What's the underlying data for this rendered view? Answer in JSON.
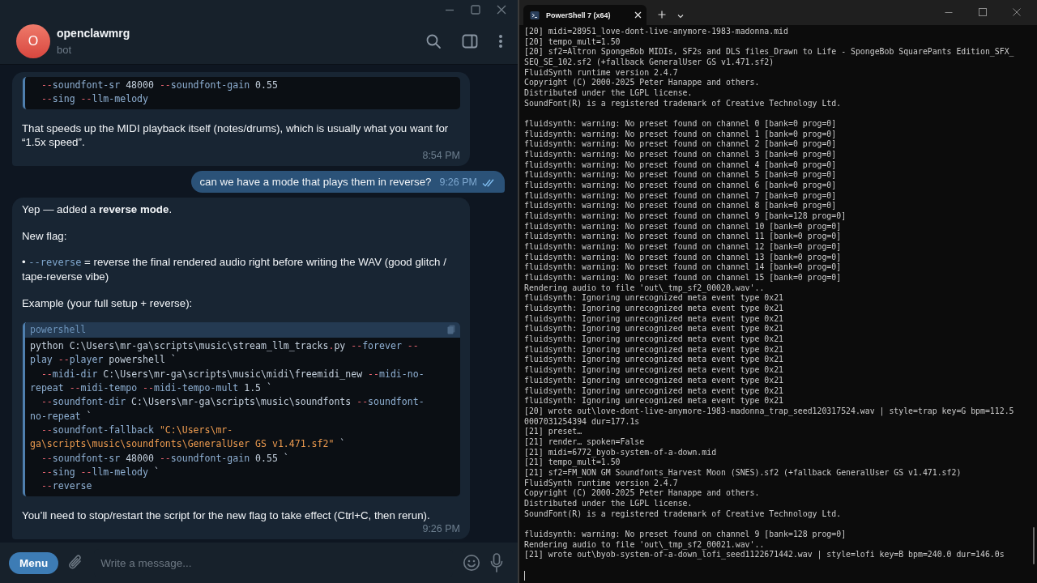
{
  "chat": {
    "avatar_letter": "O",
    "name": "openclawmrg",
    "status": "bot"
  },
  "messages": [
    {
      "kind": "in",
      "time": "8:54 PM",
      "blocks": [
        {
          "kind": "code",
          "lines": [
            {
              "indent": true,
              "tokens": [
                {
                  "kind": "op",
                  "text": "--"
                },
                {
                  "kind": "param",
                  "text": "soundfont-sr"
                },
                {
                  "kind": "plain",
                  "text": " 48000 "
                },
                {
                  "kind": "op",
                  "text": "--"
                },
                {
                  "kind": "param",
                  "text": "soundfont-gain"
                },
                {
                  "kind": "plain",
                  "text": " 0.55"
                }
              ]
            },
            {
              "indent": true,
              "tokens": [
                {
                  "kind": "op",
                  "text": "--"
                },
                {
                  "kind": "param",
                  "text": "sing "
                },
                {
                  "kind": "op",
                  "text": "--"
                },
                {
                  "kind": "param",
                  "text": "llm-melody"
                }
              ]
            }
          ]
        },
        {
          "kind": "text",
          "parts": [
            {
              "kind": "plain",
              "text": "That speeds up the MIDI playback itself (notes/drums), which is usually what you want for “1.5x speed”."
            }
          ]
        }
      ]
    },
    {
      "kind": "out",
      "time": "9:26 PM",
      "read": true,
      "blocks": [
        {
          "kind": "text",
          "parts": [
            {
              "kind": "plain",
              "text": "can we have a mode that plays them in reverse?"
            }
          ]
        }
      ]
    },
    {
      "kind": "in",
      "time": "9:26 PM",
      "blocks": [
        {
          "kind": "text",
          "parts": [
            {
              "kind": "plain",
              "text": "Yep — added a "
            },
            {
              "kind": "bold",
              "text": "reverse mode"
            },
            {
              "kind": "plain",
              "text": "."
            }
          ]
        },
        {
          "kind": "text",
          "parts": [
            {
              "kind": "plain",
              "text": "New flag:"
            }
          ]
        },
        {
          "kind": "text",
          "parts": [
            {
              "kind": "plain",
              "text": "• "
            },
            {
              "kind": "code",
              "text": "--reverse"
            },
            {
              "kind": "plain",
              "text": " = reverse the final rendered audio right before writing the WAV (good glitch / tape-reverse vibe)"
            }
          ]
        },
        {
          "kind": "text",
          "parts": [
            {
              "kind": "plain",
              "text": "Example (your full setup + reverse):"
            }
          ]
        },
        {
          "kind": "code",
          "language": "powershell",
          "lines": [
            {
              "indent": false,
              "tokens": [
                {
                  "kind": "plain",
                  "text": "python C:\\Users\\mr-ga\\scripts\\music\\stream_llm_tracks"
                },
                {
                  "kind": "op",
                  "text": "."
                },
                {
                  "kind": "plain",
                  "text": "py "
                },
                {
                  "kind": "op",
                  "text": "--"
                },
                {
                  "kind": "param",
                  "text": "forever "
                },
                {
                  "kind": "op",
                  "text": "--"
                }
              ]
            },
            {
              "indent": false,
              "tokens": [
                {
                  "kind": "param",
                  "text": "play "
                },
                {
                  "kind": "op",
                  "text": "--"
                },
                {
                  "kind": "param",
                  "text": "player"
                },
                {
                  "kind": "plain",
                  "text": " powershell `"
                }
              ]
            },
            {
              "indent": true,
              "tokens": [
                {
                  "kind": "op",
                  "text": "--"
                },
                {
                  "kind": "param",
                  "text": "midi-dir"
                },
                {
                  "kind": "plain",
                  "text": " C:\\Users\\mr-ga\\scripts\\music\\midi\\freemidi_new "
                },
                {
                  "kind": "op",
                  "text": "--"
                },
                {
                  "kind": "param",
                  "text": "midi-no-"
                }
              ]
            },
            {
              "indent": false,
              "tokens": [
                {
                  "kind": "param",
                  "text": "repeat "
                },
                {
                  "kind": "op",
                  "text": "--"
                },
                {
                  "kind": "param",
                  "text": "midi-tempo "
                },
                {
                  "kind": "op",
                  "text": "--"
                },
                {
                  "kind": "param",
                  "text": "midi-tempo-mult"
                },
                {
                  "kind": "plain",
                  "text": " 1.5 `"
                }
              ]
            },
            {
              "indent": true,
              "tokens": [
                {
                  "kind": "op",
                  "text": "--"
                },
                {
                  "kind": "param",
                  "text": "soundfont-dir"
                },
                {
                  "kind": "plain",
                  "text": " C:\\Users\\mr-ga\\scripts\\music\\soundfonts "
                },
                {
                  "kind": "op",
                  "text": "--"
                },
                {
                  "kind": "param",
                  "text": "soundfont-"
                }
              ]
            },
            {
              "indent": false,
              "tokens": [
                {
                  "kind": "param",
                  "text": "no-repeat"
                },
                {
                  "kind": "plain",
                  "text": " `"
                }
              ]
            },
            {
              "indent": true,
              "tokens": [
                {
                  "kind": "op",
                  "text": "--"
                },
                {
                  "kind": "param",
                  "text": "soundfont-fallback"
                },
                {
                  "kind": "str",
                  "text": " \"C:\\Users\\mr-"
                }
              ]
            },
            {
              "indent": false,
              "tokens": [
                {
                  "kind": "str",
                  "text": "ga\\scripts\\music\\soundfonts\\GeneralUser GS v1.471.sf2\""
                },
                {
                  "kind": "plain",
                  "text": " `"
                }
              ]
            },
            {
              "indent": true,
              "tokens": [
                {
                  "kind": "op",
                  "text": "--"
                },
                {
                  "kind": "param",
                  "text": "soundfont-sr"
                },
                {
                  "kind": "plain",
                  "text": " 48000 "
                },
                {
                  "kind": "op",
                  "text": "--"
                },
                {
                  "kind": "param",
                  "text": "soundfont-gain"
                },
                {
                  "kind": "plain",
                  "text": " 0.55 `"
                }
              ]
            },
            {
              "indent": true,
              "tokens": [
                {
                  "kind": "op",
                  "text": "--"
                },
                {
                  "kind": "param",
                  "text": "sing "
                },
                {
                  "kind": "op",
                  "text": "--"
                },
                {
                  "kind": "param",
                  "text": "llm-melody"
                },
                {
                  "kind": "plain",
                  "text": " `"
                }
              ]
            },
            {
              "indent": true,
              "tokens": [
                {
                  "kind": "op",
                  "text": "--"
                },
                {
                  "kind": "param",
                  "text": "reverse"
                }
              ]
            }
          ]
        },
        {
          "kind": "text",
          "parts": [
            {
              "kind": "plain",
              "text": "You’ll need to stop/restart the script for the new flag to take effect (Ctrl+C, then rerun)."
            }
          ]
        }
      ]
    }
  ],
  "composer": {
    "menu_button": "Menu",
    "placeholder": "Write a message..."
  },
  "terminal": {
    "tabs": [
      {
        "title": "PowerShell 7 (x64)",
        "selected": true
      }
    ],
    "blocks": [
      [
        "[20] midi=28951_love-dont-live-anymore-1983-madonna.mid",
        "[20] tempo_mult=1.50",
        "[20] sf2=Altron SpongeBob MIDIs, SF2s and DLS files_Drawn to Life - SpongeBob SquarePants Edition_SFX_",
        "SEQ_SE_102.sf2 (+fallback GeneralUser GS v1.471.sf2)",
        "FluidSynth runtime version 2.4.7",
        "Copyright (C) 2000-2025 Peter Hanappe and others.",
        "Distributed under the LGPL license.",
        "SoundFont(R) is a registered trademark of Creative Technology Ltd."
      ],
      [
        "fluidsynth: warning: No preset found on channel 0 [bank=0 prog=0]",
        "fluidsynth: warning: No preset found on channel 1 [bank=0 prog=0]",
        "fluidsynth: warning: No preset found on channel 2 [bank=0 prog=0]",
        "fluidsynth: warning: No preset found on channel 3 [bank=0 prog=0]",
        "fluidsynth: warning: No preset found on channel 4 [bank=0 prog=0]",
        "fluidsynth: warning: No preset found on channel 5 [bank=0 prog=0]",
        "fluidsynth: warning: No preset found on channel 6 [bank=0 prog=0]",
        "fluidsynth: warning: No preset found on channel 7 [bank=0 prog=0]",
        "fluidsynth: warning: No preset found on channel 8 [bank=0 prog=0]",
        "fluidsynth: warning: No preset found on channel 9 [bank=128 prog=0]",
        "fluidsynth: warning: No preset found on channel 10 [bank=0 prog=0]",
        "fluidsynth: warning: No preset found on channel 11 [bank=0 prog=0]",
        "fluidsynth: warning: No preset found on channel 12 [bank=0 prog=0]",
        "fluidsynth: warning: No preset found on channel 13 [bank=0 prog=0]",
        "fluidsynth: warning: No preset found on channel 14 [bank=0 prog=0]",
        "fluidsynth: warning: No preset found on channel 15 [bank=0 prog=0]",
        "Rendering audio to file 'out\\_tmp_sf2_00020.wav'..",
        "fluidsynth: Ignoring unrecognized meta event type 0x21",
        "fluidsynth: Ignoring unrecognized meta event type 0x21",
        "fluidsynth: Ignoring unrecognized meta event type 0x21",
        "fluidsynth: Ignoring unrecognized meta event type 0x21",
        "fluidsynth: Ignoring unrecognized meta event type 0x21",
        "fluidsynth: Ignoring unrecognized meta event type 0x21",
        "fluidsynth: Ignoring unrecognized meta event type 0x21",
        "fluidsynth: Ignoring unrecognized meta event type 0x21",
        "fluidsynth: Ignoring unrecognized meta event type 0x21",
        "fluidsynth: Ignoring unrecognized meta event type 0x21",
        "fluidsynth: Ignoring unrecognized meta event type 0x21",
        "[20] wrote out\\love-dont-live-anymore-1983-madonna_trap_seed120317524.wav | style=trap key=G bpm=112.5",
        "0007031254394 dur=177.1s",
        "[21] preset…",
        "[21] render… spoken=False",
        "[21] midi=6772_byob-system-of-a-down.mid",
        "[21] tempo_mult=1.50",
        "[21] sf2=FM_NON GM Soundfonts_Harvest Moon (SNES).sf2 (+fallback GeneralUser GS v1.471.sf2)",
        "FluidSynth runtime version 2.4.7",
        "Copyright (C) 2000-2025 Peter Hanappe and others.",
        "Distributed under the LGPL license.",
        "SoundFont(R) is a registered trademark of Creative Technology Ltd."
      ],
      [
        "fluidsynth: warning: No preset found on channel 9 [bank=128 prog=0]",
        "Rendering audio to file 'out\\_tmp_sf2_00021.wav'..",
        "[21] wrote out\\byob-system-of-a-down_lofi_seed1122671442.wav | style=lofi key=B bpm=240.0 dur=146.0s"
      ]
    ]
  }
}
